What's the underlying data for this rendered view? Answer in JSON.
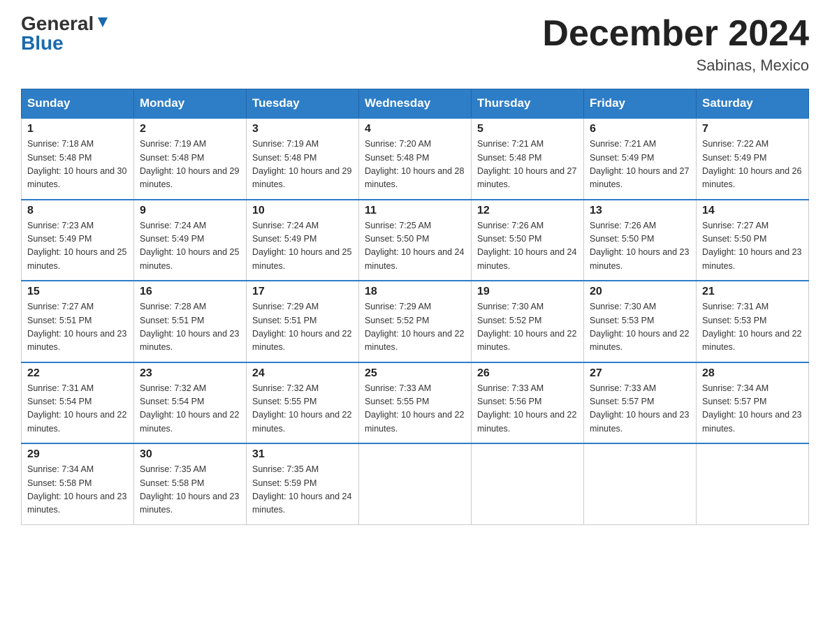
{
  "header": {
    "logo_line1": "General",
    "logo_line2": "Blue",
    "month_title": "December 2024",
    "location": "Sabinas, Mexico"
  },
  "days_of_week": [
    "Sunday",
    "Monday",
    "Tuesday",
    "Wednesday",
    "Thursday",
    "Friday",
    "Saturday"
  ],
  "weeks": [
    [
      {
        "day": "1",
        "sunrise": "7:18 AM",
        "sunset": "5:48 PM",
        "daylight": "10 hours and 30 minutes."
      },
      {
        "day": "2",
        "sunrise": "7:19 AM",
        "sunset": "5:48 PM",
        "daylight": "10 hours and 29 minutes."
      },
      {
        "day": "3",
        "sunrise": "7:19 AM",
        "sunset": "5:48 PM",
        "daylight": "10 hours and 29 minutes."
      },
      {
        "day": "4",
        "sunrise": "7:20 AM",
        "sunset": "5:48 PM",
        "daylight": "10 hours and 28 minutes."
      },
      {
        "day": "5",
        "sunrise": "7:21 AM",
        "sunset": "5:48 PM",
        "daylight": "10 hours and 27 minutes."
      },
      {
        "day": "6",
        "sunrise": "7:21 AM",
        "sunset": "5:49 PM",
        "daylight": "10 hours and 27 minutes."
      },
      {
        "day": "7",
        "sunrise": "7:22 AM",
        "sunset": "5:49 PM",
        "daylight": "10 hours and 26 minutes."
      }
    ],
    [
      {
        "day": "8",
        "sunrise": "7:23 AM",
        "sunset": "5:49 PM",
        "daylight": "10 hours and 25 minutes."
      },
      {
        "day": "9",
        "sunrise": "7:24 AM",
        "sunset": "5:49 PM",
        "daylight": "10 hours and 25 minutes."
      },
      {
        "day": "10",
        "sunrise": "7:24 AM",
        "sunset": "5:49 PM",
        "daylight": "10 hours and 25 minutes."
      },
      {
        "day": "11",
        "sunrise": "7:25 AM",
        "sunset": "5:50 PM",
        "daylight": "10 hours and 24 minutes."
      },
      {
        "day": "12",
        "sunrise": "7:26 AM",
        "sunset": "5:50 PM",
        "daylight": "10 hours and 24 minutes."
      },
      {
        "day": "13",
        "sunrise": "7:26 AM",
        "sunset": "5:50 PM",
        "daylight": "10 hours and 23 minutes."
      },
      {
        "day": "14",
        "sunrise": "7:27 AM",
        "sunset": "5:50 PM",
        "daylight": "10 hours and 23 minutes."
      }
    ],
    [
      {
        "day": "15",
        "sunrise": "7:27 AM",
        "sunset": "5:51 PM",
        "daylight": "10 hours and 23 minutes."
      },
      {
        "day": "16",
        "sunrise": "7:28 AM",
        "sunset": "5:51 PM",
        "daylight": "10 hours and 23 minutes."
      },
      {
        "day": "17",
        "sunrise": "7:29 AM",
        "sunset": "5:51 PM",
        "daylight": "10 hours and 22 minutes."
      },
      {
        "day": "18",
        "sunrise": "7:29 AM",
        "sunset": "5:52 PM",
        "daylight": "10 hours and 22 minutes."
      },
      {
        "day": "19",
        "sunrise": "7:30 AM",
        "sunset": "5:52 PM",
        "daylight": "10 hours and 22 minutes."
      },
      {
        "day": "20",
        "sunrise": "7:30 AM",
        "sunset": "5:53 PM",
        "daylight": "10 hours and 22 minutes."
      },
      {
        "day": "21",
        "sunrise": "7:31 AM",
        "sunset": "5:53 PM",
        "daylight": "10 hours and 22 minutes."
      }
    ],
    [
      {
        "day": "22",
        "sunrise": "7:31 AM",
        "sunset": "5:54 PM",
        "daylight": "10 hours and 22 minutes."
      },
      {
        "day": "23",
        "sunrise": "7:32 AM",
        "sunset": "5:54 PM",
        "daylight": "10 hours and 22 minutes."
      },
      {
        "day": "24",
        "sunrise": "7:32 AM",
        "sunset": "5:55 PM",
        "daylight": "10 hours and 22 minutes."
      },
      {
        "day": "25",
        "sunrise": "7:33 AM",
        "sunset": "5:55 PM",
        "daylight": "10 hours and 22 minutes."
      },
      {
        "day": "26",
        "sunrise": "7:33 AM",
        "sunset": "5:56 PM",
        "daylight": "10 hours and 22 minutes."
      },
      {
        "day": "27",
        "sunrise": "7:33 AM",
        "sunset": "5:57 PM",
        "daylight": "10 hours and 23 minutes."
      },
      {
        "day": "28",
        "sunrise": "7:34 AM",
        "sunset": "5:57 PM",
        "daylight": "10 hours and 23 minutes."
      }
    ],
    [
      {
        "day": "29",
        "sunrise": "7:34 AM",
        "sunset": "5:58 PM",
        "daylight": "10 hours and 23 minutes."
      },
      {
        "day": "30",
        "sunrise": "7:35 AM",
        "sunset": "5:58 PM",
        "daylight": "10 hours and 23 minutes."
      },
      {
        "day": "31",
        "sunrise": "7:35 AM",
        "sunset": "5:59 PM",
        "daylight": "10 hours and 24 minutes."
      },
      null,
      null,
      null,
      null
    ]
  ]
}
